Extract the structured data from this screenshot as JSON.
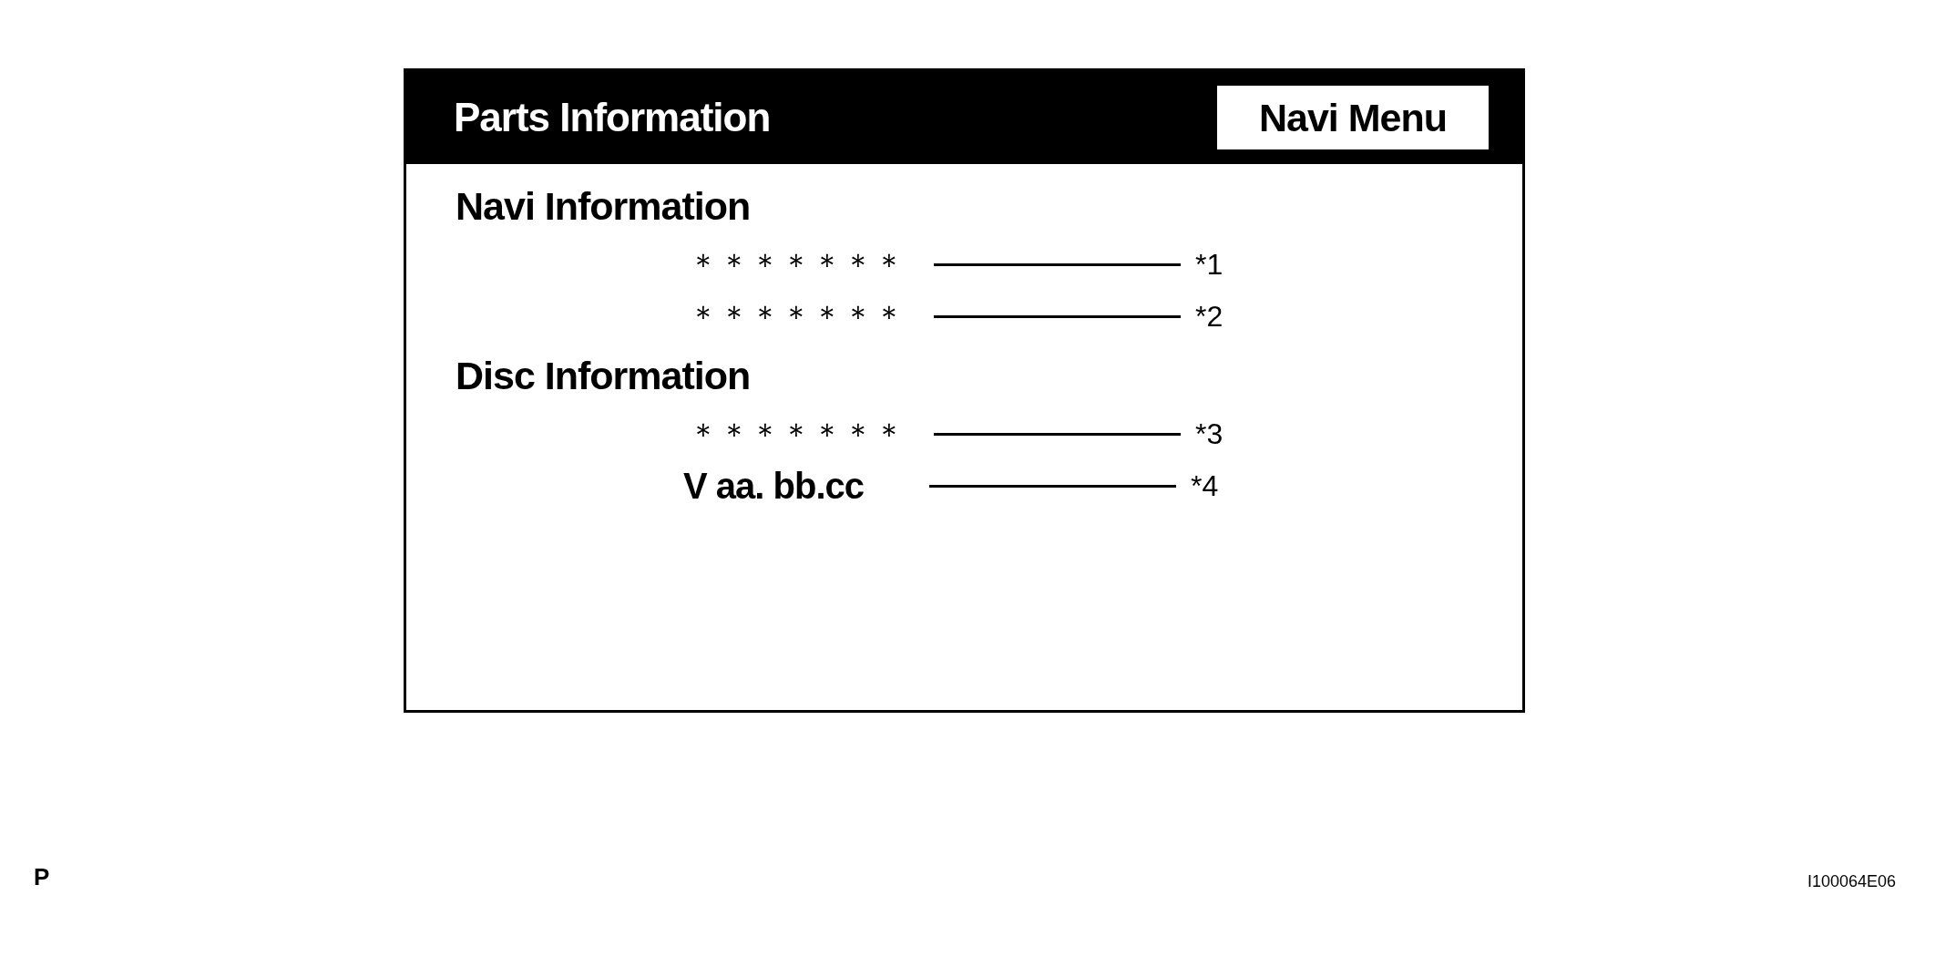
{
  "screen": {
    "title": "Parts Information",
    "menu_button": "Navi Menu",
    "sections": [
      {
        "heading": "Navi Information",
        "items": [
          {
            "value": "＊＊＊＊＊＊＊",
            "ref": "*1"
          },
          {
            "value": "＊＊＊＊＊＊＊",
            "ref": "*2"
          }
        ]
      },
      {
        "heading": "Disc Information",
        "items": [
          {
            "value": "＊＊＊＊＊＊＊",
            "ref": "*3"
          },
          {
            "value": "V aa. bb.cc",
            "ref": "*4"
          }
        ]
      }
    ]
  },
  "footer": {
    "left": "P",
    "right": "I100064E06"
  }
}
